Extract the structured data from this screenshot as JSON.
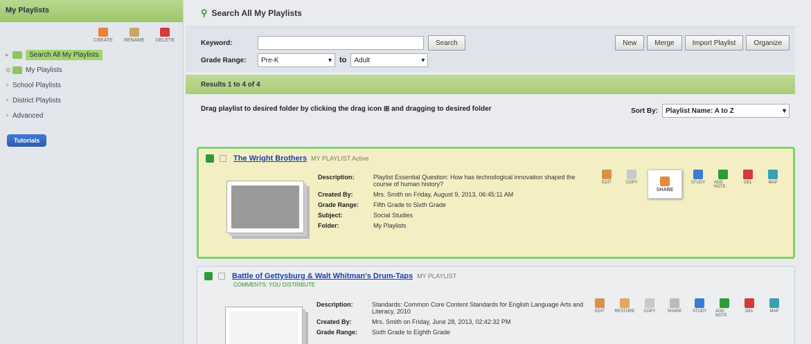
{
  "sidebar": {
    "title": "My Playlists",
    "tools": [
      {
        "label": "CREATE",
        "icon": "new-folder-icon",
        "color": "#e8823a"
      },
      {
        "label": "RENAME",
        "icon": "rename-icon",
        "color": "#c8a766"
      },
      {
        "label": "DELETE",
        "icon": "delete-icon",
        "color": "#d33a3a"
      }
    ],
    "tree": [
      {
        "label": "Search All My Playlists",
        "active": true
      },
      {
        "label": "My Playlists",
        "active": false
      },
      {
        "label": "School Playlists",
        "active": false
      },
      {
        "label": "District Playlists",
        "active": false
      },
      {
        "label": "Advanced",
        "active": false
      }
    ],
    "button": "Tutorials"
  },
  "main": {
    "title": "Search All My Playlists",
    "keyword_label": "Keyword:",
    "keyword_value": "",
    "search_button": "Search",
    "grade_label": "Grade Range:",
    "grade_from": "Pre-K",
    "to_label": "to",
    "grade_to": "Adult",
    "buttons": [
      "New",
      "Merge",
      "Import Playlist",
      "Organize"
    ],
    "results_label": "Results 1 to 4 of 4",
    "drag_text": "Drag playlist to desired folder by clicking the drag icon ⊞ and dragging to desired folder",
    "sort_label": "Sort By:",
    "sort_value": "Playlist Name: A to Z"
  },
  "cards": [
    {
      "title": "The Wright Brothers",
      "tag": "MY PLAYLIST  Active",
      "subtag": "",
      "details": [
        {
          "k": "Description:",
          "v": "Playlist Essential Question: How has technological innovation shaped the course of human history?"
        },
        {
          "k": "Created By:",
          "v": "Mrs. Smith on Friday, August 9, 2013, 06:45:11 AM"
        },
        {
          "k": "Grade Range:",
          "v": "Fifth Grade to Sixth Grade"
        },
        {
          "k": "Subject:",
          "v": "Social Studies"
        },
        {
          "k": "Folder:",
          "v": "My Playlists"
        }
      ],
      "actions": [
        "EDIT",
        "COPY",
        "SHARE",
        "STUDY",
        "ADD NOTE",
        "DEL",
        "MAP"
      ]
    },
    {
      "title": "Battle of Gettysburg & Walt Whitman's Drum-Taps",
      "tag": "MY PLAYLIST",
      "subtag": "COMMENTS: YOU DISTRIBUTE",
      "details": [
        {
          "k": "Description:",
          "v": "Standards: Common Core Content Standards for English Language Arts and Literacy, 2010"
        },
        {
          "k": "Created By:",
          "v": "Mrs. Smith on Friday, June 28, 2013, 02:42:32 PM"
        },
        {
          "k": "Grade Range:",
          "v": "Sixth Grade to Eighth Grade"
        }
      ],
      "actions": [
        "EDIT",
        "RESTORE",
        "COPY",
        "SHARE",
        "STUDY",
        "ADD NOTE",
        "DEL",
        "MAP"
      ]
    }
  ],
  "colors": {
    "accent_green": "#9cc56a",
    "highlight_card": "#f3efc3",
    "link_blue": "#1a3fb0"
  }
}
